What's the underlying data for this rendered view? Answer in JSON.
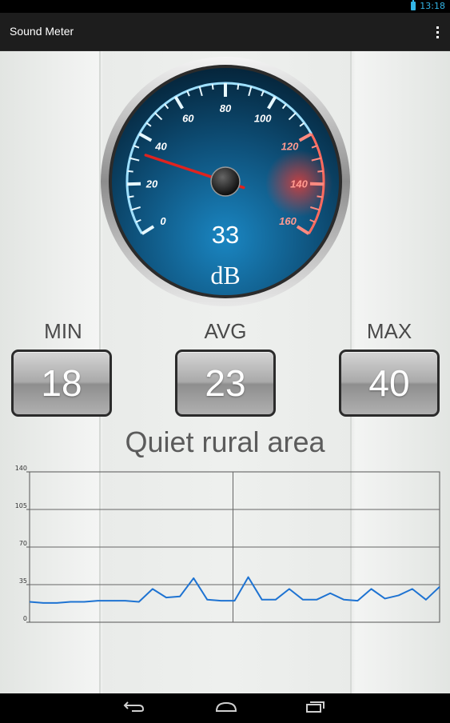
{
  "status_bar": {
    "time": "13:18"
  },
  "app": {
    "title": "Sound Meter"
  },
  "gauge": {
    "value": "33",
    "unit": "dB",
    "needle_value": 33,
    "scale_labels": [
      "0",
      "20",
      "40",
      "60",
      "80",
      "100",
      "120",
      "140",
      "160"
    ],
    "min_value": 0,
    "max_value": 160,
    "danger_from": 120
  },
  "stats": {
    "min": {
      "label": "MIN",
      "value": "18"
    },
    "avg": {
      "label": "AVG",
      "value": "23"
    },
    "max": {
      "label": "MAX",
      "value": "40"
    }
  },
  "description": "Quiet rural area",
  "chart_data": {
    "type": "line",
    "y_ticks": [
      "0",
      "35",
      "70",
      "105",
      "140"
    ],
    "ylim": [
      0,
      140
    ],
    "grid": true,
    "series": [
      {
        "values": [
          19,
          18,
          18,
          19,
          19,
          20,
          20,
          20,
          19,
          31,
          23,
          24,
          41,
          21,
          20,
          20,
          42,
          21,
          21,
          31,
          21,
          21,
          27,
          21,
          20,
          31,
          22,
          25,
          31,
          21,
          33
        ]
      }
    ],
    "line_color": "#1e73d2"
  },
  "colors": {
    "accent": "#33b5e5",
    "needle": "#e0231f",
    "gauge_face": "#0e5a86"
  },
  "nav": {
    "icons": [
      "back-icon",
      "home-icon",
      "recent-apps-icon"
    ]
  }
}
